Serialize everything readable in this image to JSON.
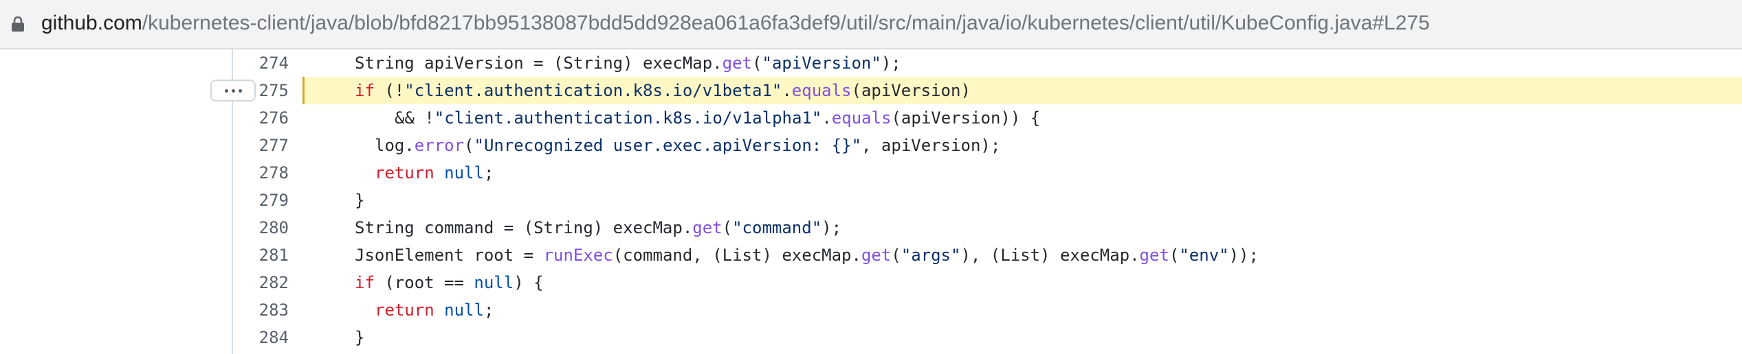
{
  "address_bar": {
    "host": "github.com",
    "path": "/kubernetes-client/java/blob/bfd8217bb95138087bdd5dd928ea061a6fa3def9/util/src/main/java/io/kubernetes/client/util/KubeConfig.java#L275",
    "lock_icon": "lock-icon"
  },
  "code": {
    "highlighted_line": "275",
    "more_button_icon": "ellipsis-icon",
    "colors": {
      "keyword": "#cf222e",
      "function": "#8250df",
      "string": "#0a3069",
      "highlight": "#fff8c5"
    },
    "lines": [
      {
        "number": "274",
        "t": [
          "String apiVersion = (String) execMap.",
          "get",
          "(",
          "\"apiVersion\"",
          ");"
        ]
      },
      {
        "number": "275",
        "t": [
          "if",
          " (!",
          "\"client.authentication.k8s.io/v1beta1\"",
          ".",
          "equals",
          "(apiVersion)"
        ]
      },
      {
        "number": "276",
        "t": [
          "&& !",
          "\"client.authentication.k8s.io/v1alpha1\"",
          ".",
          "equals",
          "(apiVersion)) {"
        ]
      },
      {
        "number": "277",
        "t": [
          "log.",
          "error",
          "(",
          "\"Unrecognized user.exec.apiVersion: {}\"",
          ", apiVersion);"
        ]
      },
      {
        "number": "278",
        "t": [
          "return",
          " ",
          "null",
          ";"
        ]
      },
      {
        "number": "279",
        "t": [
          "}"
        ]
      },
      {
        "number": "280",
        "t": [
          "String command = (String) execMap.",
          "get",
          "(",
          "\"command\"",
          ");"
        ]
      },
      {
        "number": "281",
        "t": [
          "JsonElement root = ",
          "runExec",
          "(command, (List) execMap.",
          "get",
          "(",
          "\"args\"",
          "), (List) execMap.",
          "get",
          "(",
          "\"env\"",
          "));"
        ]
      },
      {
        "number": "282",
        "t": [
          "if",
          " (root == ",
          "null",
          ") {"
        ]
      },
      {
        "number": "283",
        "t": [
          "return",
          " ",
          "null",
          ";"
        ]
      },
      {
        "number": "284",
        "t": [
          "}"
        ]
      }
    ]
  }
}
